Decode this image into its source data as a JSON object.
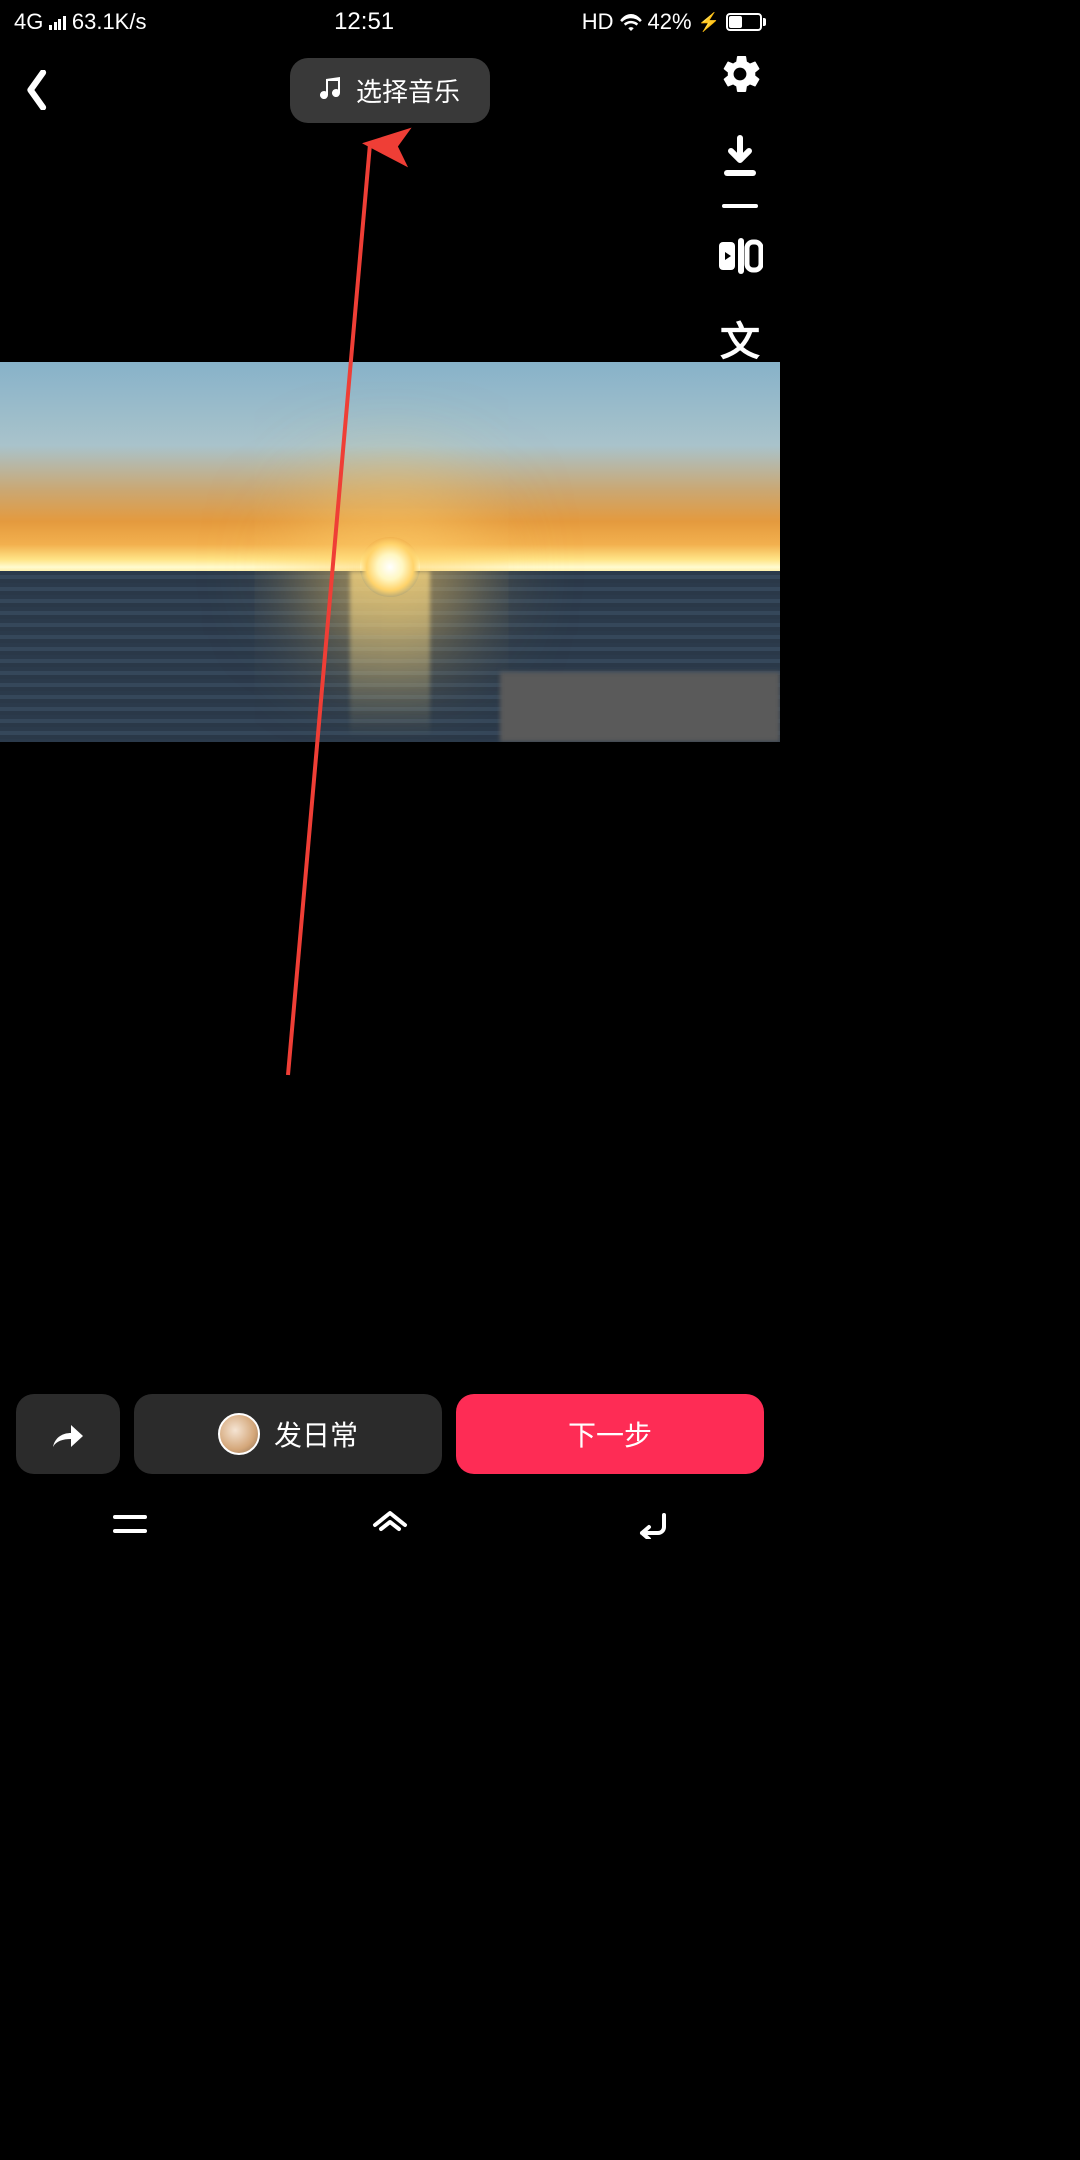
{
  "status": {
    "network_type": "4G",
    "speed": "63.1K/s",
    "time": "12:51",
    "hd": "HD",
    "battery_pct": "42%"
  },
  "header": {
    "music_label": "选择音乐"
  },
  "tools": {
    "text_label": "文"
  },
  "bottom": {
    "daily_label": "发日常",
    "next_label": "下一步"
  },
  "colors": {
    "accent": "#FE2C55",
    "pill": "#2B2B2B",
    "arrow": "#EF3E36"
  }
}
